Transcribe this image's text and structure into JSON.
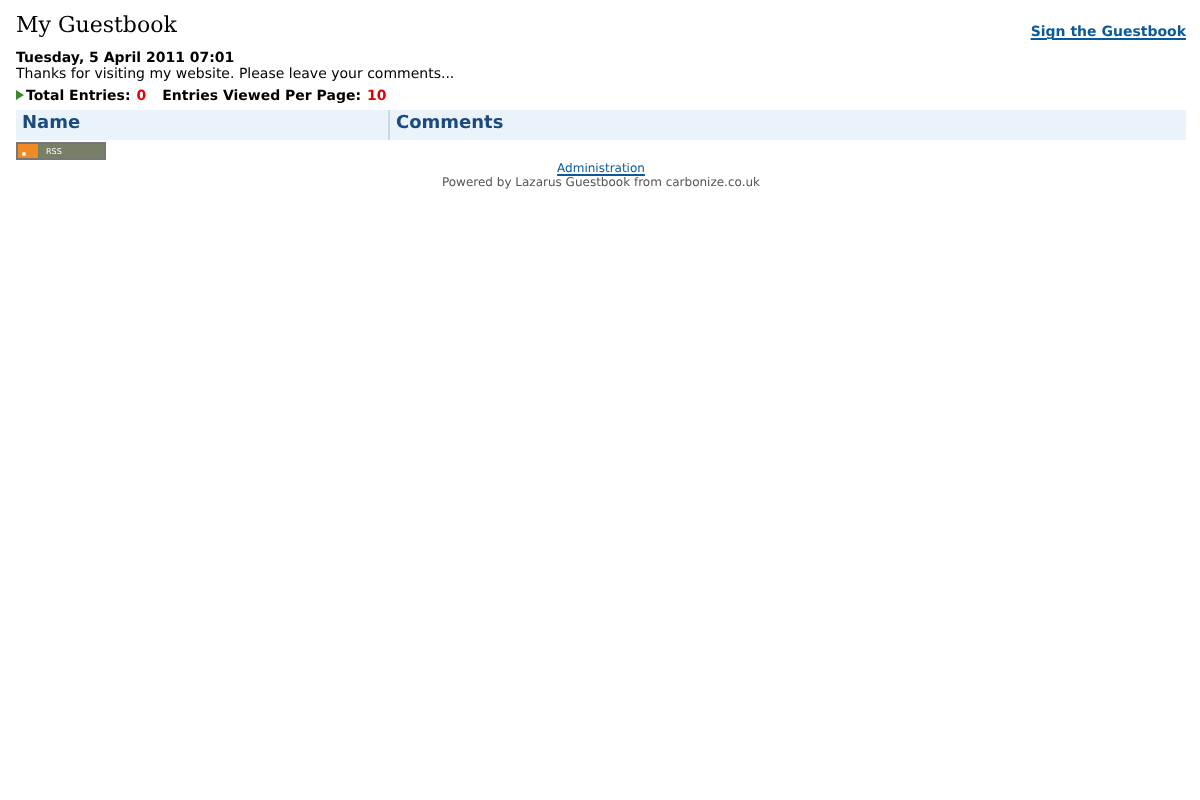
{
  "header": {
    "title": "My Guestbook",
    "sign_link": "Sign the Guestbook"
  },
  "date": "Tuesday, 5 April 2011 07:01",
  "intro": "Thanks for visiting my website. Please leave your comments...",
  "stats": [
    {
      "label": "Total Entries:",
      "value": "0"
    },
    {
      "label": "Entries Viewed Per Page:",
      "value": "10"
    }
  ],
  "table": {
    "columns": [
      "Name",
      "Comments"
    ]
  },
  "rss_badge": "RSS",
  "footer": {
    "admin_link": "Administration",
    "powered_by": "Powered by Lazarus Guestbook from carbonize.co.uk"
  }
}
